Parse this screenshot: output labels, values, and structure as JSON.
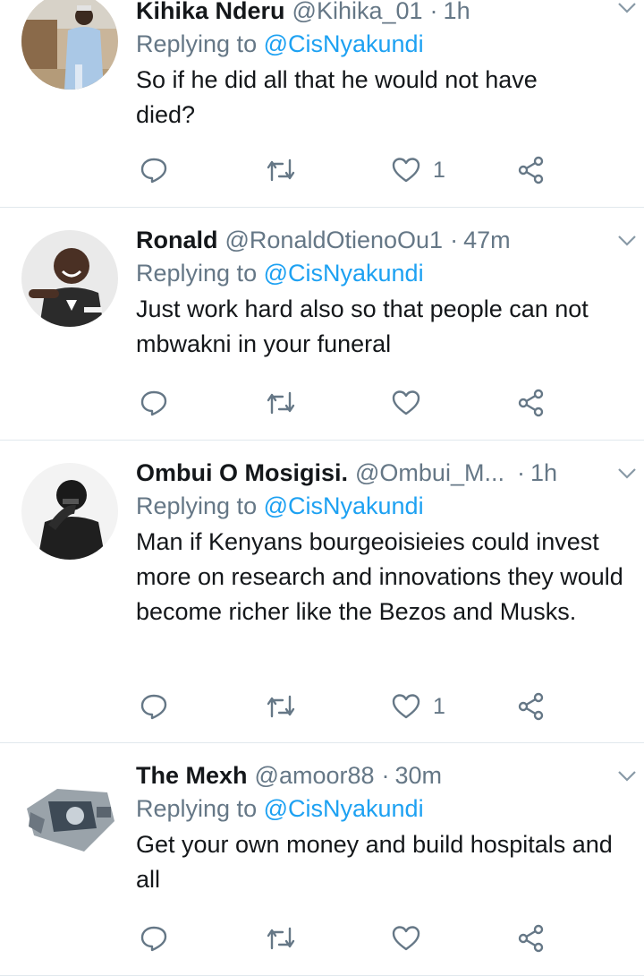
{
  "tweets": [
    {
      "name": "Kihika Nderu",
      "handle": "@Kihika_01",
      "separator": "·",
      "time": "1h",
      "replying_prefix": "Replying to",
      "replying_to": "@CisNyakundi",
      "text": "So if he did all that he would not have died?",
      "likes": "1"
    },
    {
      "name": "Ronald",
      "handle": "@RonaldOtienoOu1",
      "separator": "·",
      "time": "47m",
      "replying_prefix": "Replying to",
      "replying_to": "@CisNyakundi",
      "text": "Just work hard also so that people can not mbwakni in your funeral",
      "likes": ""
    },
    {
      "name": "Ombui O Mosigisi.",
      "handle": "@Ombui_M...",
      "separator": "·",
      "time": "1h",
      "replying_prefix": "Replying to",
      "replying_to": "@CisNyakundi",
      "text": "Man if Kenyans bourgeoisieies could invest more on research and innovations they would become richer like the Bezos and Musks.",
      "likes": "1"
    },
    {
      "name": "The Mexh",
      "handle": "@amoor88",
      "separator": "·",
      "time": "30m",
      "replying_prefix": "Replying to",
      "replying_to": "@CisNyakundi",
      "text": "Get your own money and build hospitals and all",
      "likes": ""
    }
  ],
  "icons": {
    "reply": "reply-bubble-icon",
    "retweet": "retweet-icon",
    "like": "heart-icon",
    "share": "share-icon",
    "more": "chevron-down-icon"
  },
  "colors": {
    "text": "#14171a",
    "muted": "#657786",
    "mention": "#1da1f2",
    "divider": "#e1e8ed"
  }
}
